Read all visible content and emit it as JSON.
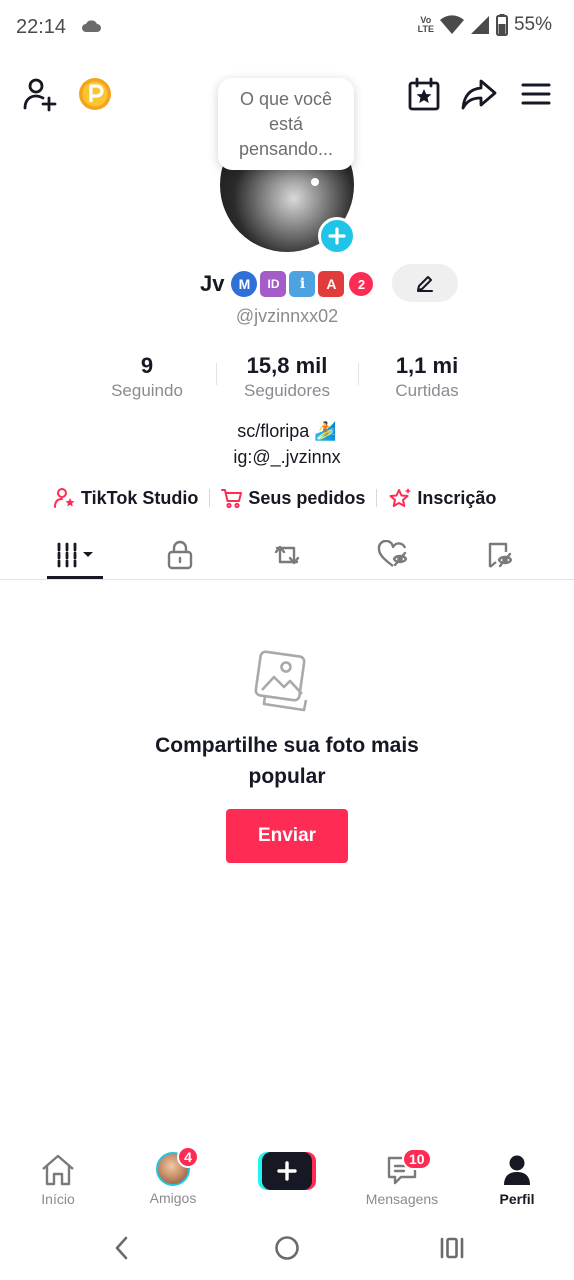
{
  "status_bar": {
    "time": "22:14",
    "volte_top": "Vo",
    "volte_bottom": "LTE",
    "battery": "55%"
  },
  "bubble": {
    "text": "O que você está pensando..."
  },
  "profile": {
    "display_name": "Jv",
    "badges": [
      "M",
      "ID",
      "i",
      "A"
    ],
    "badge_count": "2",
    "username": "@jvzinnxx02",
    "bio_line1": "sc/floripa 🏄",
    "bio_line2": "ig:@_.jvzinnx"
  },
  "stats": [
    {
      "value": "9",
      "label": "Seguindo"
    },
    {
      "value": "15,8 mil",
      "label": "Seguidores"
    },
    {
      "value": "1,1 mi",
      "label": "Curtidas"
    }
  ],
  "shortcuts": [
    {
      "label": "TikTok Studio",
      "icon": "user-star-icon"
    },
    {
      "label": "Seus pedidos",
      "icon": "cart-icon"
    },
    {
      "label": "Inscrição",
      "icon": "sparkle-star-icon"
    }
  ],
  "tabs": [
    {
      "name": "videos-grid-icon"
    },
    {
      "name": "lock-icon"
    },
    {
      "name": "repost-icon"
    },
    {
      "name": "liked-hidden-icon"
    },
    {
      "name": "favorites-hidden-icon"
    }
  ],
  "empty_state": {
    "title": "Compartilhe sua foto mais popular",
    "button": "Enviar"
  },
  "bottom_nav": {
    "home": "Início",
    "friends": "Amigos",
    "friends_badge": "4",
    "messages": "Mensagens",
    "messages_badge": "10",
    "profile": "Perfil"
  },
  "colors": {
    "accent": "#fe2c55",
    "cyan": "#20c4e6",
    "text": "#161823",
    "secondary": "#8a8b91"
  }
}
